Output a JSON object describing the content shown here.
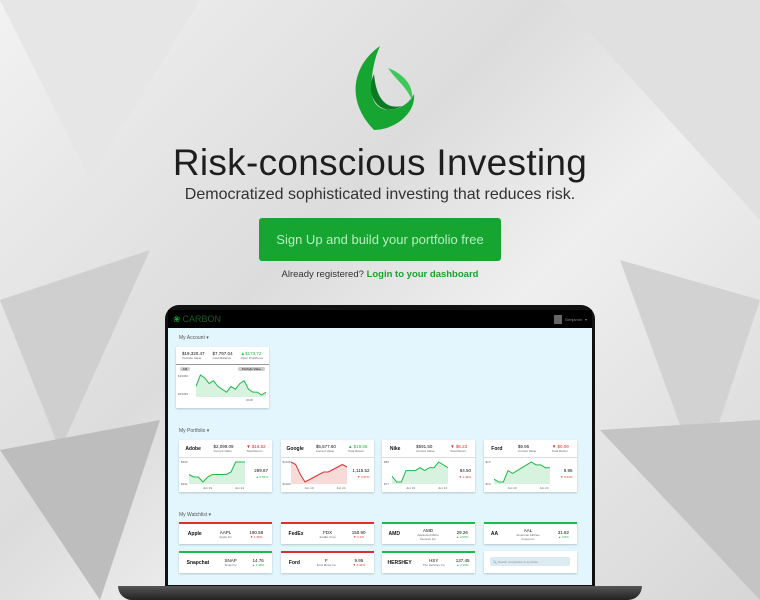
{
  "hero": {
    "title": "Risk-conscious Investing",
    "subtitle": "Democratized sophisticated investing that reduces risk.",
    "cta": "Sign Up and build your portfolio free",
    "login_prefix": "Already registered? ",
    "login_link": "Login to your dashboard"
  },
  "app": {
    "brand": "CARBON",
    "user": "Benjamin",
    "account_section": "My Account",
    "portfolio_section": "My Portfolio",
    "watchlist_section": "My Watchlist",
    "account": {
      "portfolio_value": "$19,320.47",
      "portfolio_label": "Portfolio Value",
      "cash": "$7,797.04",
      "cash_label": "Cash Balance",
      "pl": "$173.72",
      "pl_label": "Open Profit/Loss",
      "range": "1M",
      "dropdown": "Portfolio Value",
      "y_top": "$19360",
      "y_bot": "$19365",
      "x": "2018",
      "spark": [
        5,
        9,
        8,
        6,
        7,
        5,
        4,
        3,
        5,
        4,
        6,
        7,
        4,
        3,
        3,
        2,
        3
      ]
    },
    "portfolio": [
      {
        "logo": "Adobe",
        "value": "$2,099.09",
        "value_label": "Current Value",
        "ret": "$16.52",
        "ret_label": "Total Return",
        "dir": "down",
        "price": "299.87",
        "chg": "0.55%",
        "chg_dir": "up",
        "y_top": "$302",
        "y_bot": "$291",
        "x1": "Jun 19",
        "x2": "Jun 24",
        "color": "#1fb84a",
        "spark": [
          4,
          3,
          3,
          1,
          3,
          4,
          4,
          4,
          4,
          5,
          9,
          9,
          9
        ]
      },
      {
        "logo": "Google",
        "value": "$5,577.60",
        "value_label": "Current Value",
        "ret": "$19.65",
        "ret_label": "Total Return",
        "dir": "up",
        "price": "1,115.52",
        "chg": "0.57%",
        "chg_dir": "down",
        "y_top": "$1138",
        "y_bot": "$1106",
        "x1": "Jun 19",
        "x2": "Jun 24",
        "color": "#d9312c",
        "spark": [
          9,
          8,
          4,
          1,
          2,
          3,
          4,
          5,
          5,
          6,
          7,
          8,
          7
        ]
      },
      {
        "logo": "Nike",
        "value": "$591.50",
        "value_label": "Current Value",
        "ret": "$6.23",
        "ret_label": "Total Return",
        "dir": "down",
        "price": "84.50",
        "chg": "1.46%",
        "chg_dir": "down",
        "y_top": "$86",
        "y_bot": "$77",
        "x1": "Jun 19",
        "x2": "Jun 24",
        "color": "#1fb84a",
        "spark": [
          4,
          2,
          2,
          6,
          6,
          6,
          7,
          6,
          7,
          7,
          9,
          8,
          7
        ]
      },
      {
        "logo": "Ford",
        "value": "$9.95",
        "value_label": "Current Value",
        "ret": "$0.09",
        "ret_label": "Total Return",
        "dir": "down",
        "price": "9.95",
        "chg": "0.41%",
        "chg_dir": "down",
        "y_top": "$10",
        "y_bot": "$10",
        "x1": "Jun 19",
        "x2": "Jun 24",
        "color": "#1fb84a",
        "spark": [
          3,
          2,
          2,
          6,
          5,
          6,
          7,
          8,
          9,
          8,
          8,
          7,
          7
        ]
      }
    ],
    "watchlist": [
      {
        "logo": "Apple",
        "sym": "AAPL",
        "name": "Apple Inc",
        "price": "190.58",
        "chg": "1.35%",
        "dir": "down"
      },
      {
        "logo": "FedEx",
        "sym": "FDX",
        "name": "FedEx Corp",
        "price": "150.90",
        "chg": "3.1%",
        "dir": "down"
      },
      {
        "logo": "AMD",
        "sym": "AMD",
        "name": "Advanced Micro Devices Inc",
        "price": "29.26",
        "chg": "0.55%",
        "dir": "up"
      },
      {
        "logo": "AA",
        "sym": "AAL",
        "name": "American Airlines Group Inc",
        "price": "31.82",
        "chg": "0.8%",
        "dir": "up"
      },
      {
        "logo": "Snapchat",
        "sym": "SNAP",
        "name": "Snap Inc",
        "price": "14.76",
        "chg": "1.38%",
        "dir": "up"
      },
      {
        "logo": "Ford",
        "sym": "F",
        "name": "Ford Motor Co",
        "price": "9.95",
        "chg": "0.41%",
        "dir": "down"
      },
      {
        "logo": "HERSHEY",
        "sym": "HSY",
        "name": "The Hershey Co",
        "price": "137.45",
        "chg": "0.23%",
        "dir": "up"
      }
    ],
    "search_placeholder": "Search companies or symbols"
  },
  "colors": {
    "green": "#16a530",
    "up": "#1fb84a",
    "down": "#d9312c",
    "screen_bg": "#e3f6fd"
  }
}
